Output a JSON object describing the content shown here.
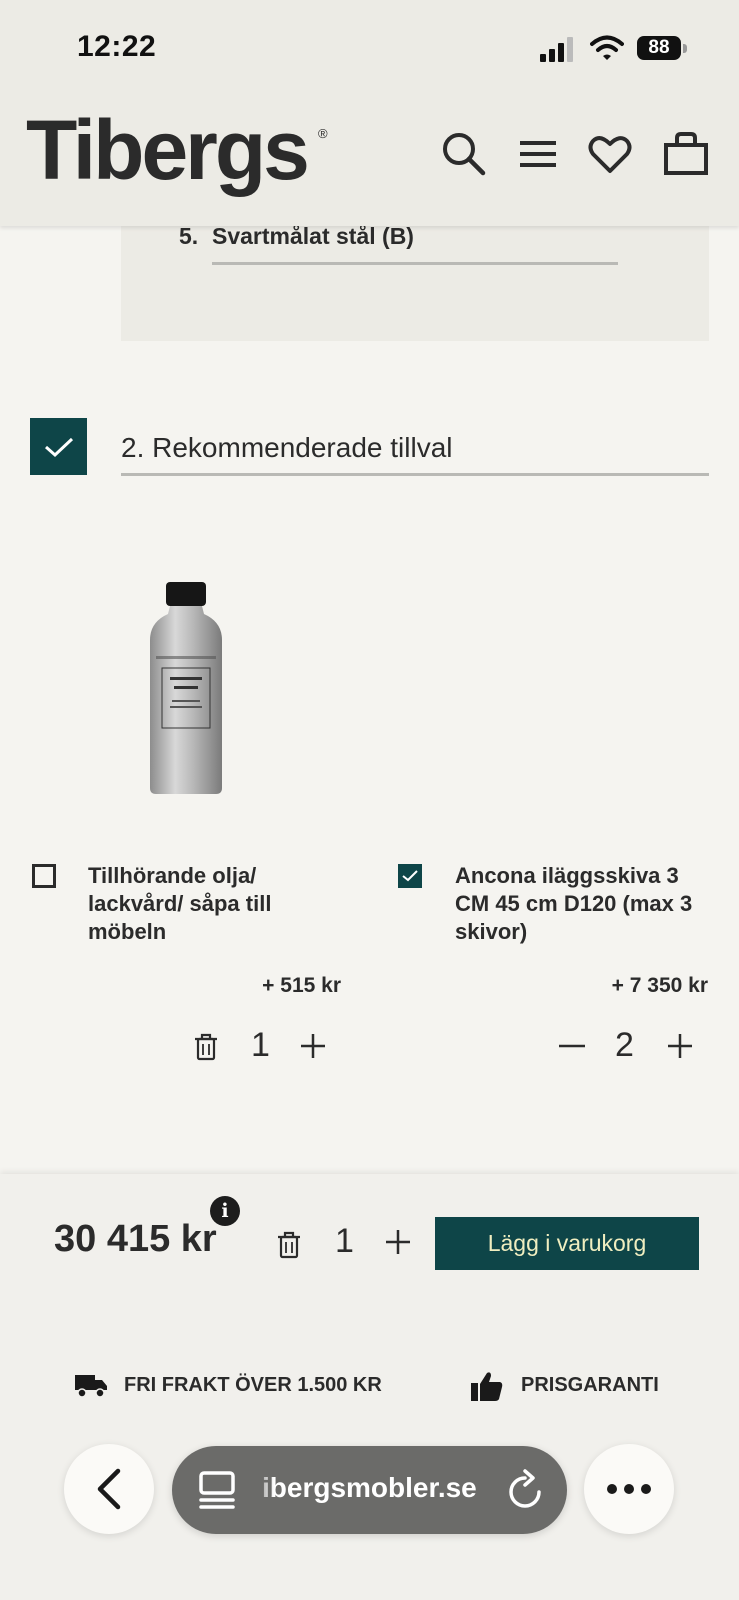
{
  "status_bar": {
    "time": "12:22",
    "battery": "88"
  },
  "header": {
    "logo": "Tibergs",
    "registered": "®"
  },
  "variant": {
    "number": "5.",
    "label": "Svartmålat stål (B)"
  },
  "section": {
    "title": "2. Rekommenderade tillval",
    "checked": true
  },
  "options": [
    {
      "label": "Tillhörande olja/ lackvård/ såpa till möbeln",
      "price": "+ 515 kr",
      "quantity": "1",
      "checked": false,
      "image": "furniture-care-bottle"
    },
    {
      "label": "Ancona iläggsskiva 3 CM 45 cm D120 (max 3 skivor)",
      "price": "+ 7 350 kr",
      "quantity": "2",
      "checked": true
    }
  ],
  "cart": {
    "total": "30 415 kr",
    "info": "i",
    "quantity": "1",
    "add_button": "Lägg i varukorg"
  },
  "usps": [
    {
      "text": "FRI FRAKT ÖVER 1.500 KR",
      "icon": "truck-icon"
    },
    {
      "text": "PRISGARANTI",
      "icon": "thumbs-up-icon"
    }
  ],
  "browser": {
    "url": "ibergsmobler.se"
  },
  "colors": {
    "brand": "#0e4548",
    "button_text": "#f0eec0",
    "header_bg": "#ecebe5"
  }
}
